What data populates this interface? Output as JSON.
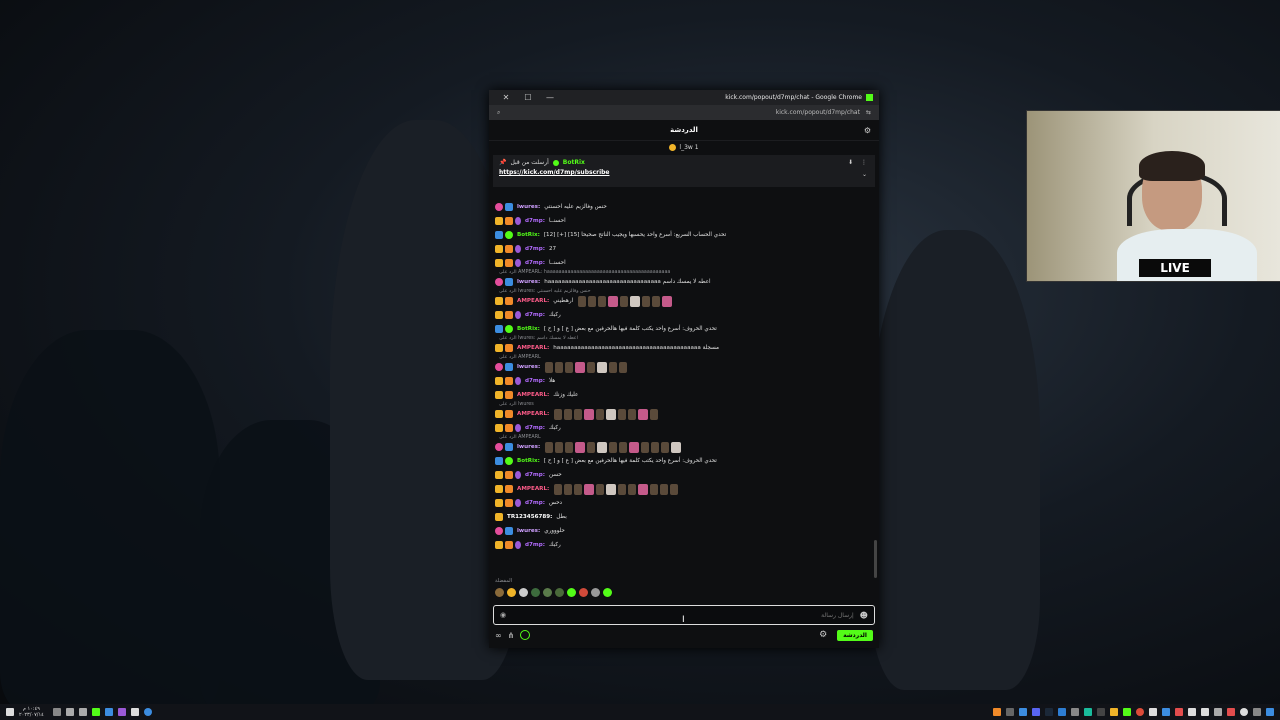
{
  "window": {
    "title": "kick.com/popout/d7mp/chat - Google Chrome",
    "url": "kick.com/popout/d7mp/chat"
  },
  "chat": {
    "header": "الدردشة",
    "sub_user": "l_3w",
    "sub_count": "1",
    "pinned": {
      "label": "أرسلت من قبل",
      "bot": "BotRix",
      "link": "https://kick.com/d7mp/subscribe"
    },
    "messages": [
      {
        "type": "msg",
        "badges": [
          "pink",
          "blue"
        ],
        "user": "lwures",
        "color": "#cfa0ff",
        "text": "حنس وفالزيم عليه احسنتي"
      },
      {
        "type": "msg",
        "badges": [
          "yellow",
          "orange",
          "purple"
        ],
        "user": "d7mp",
        "color": "#b36bff",
        "text": "احسنــا"
      },
      {
        "type": "msg",
        "badges": [
          "blue",
          "green"
        ],
        "user": "BotRix",
        "color": "#53fc18",
        "text": "[12] [+] [15] تحدي الحساب السريع: أسرع واحد يحسبها ويجيب الناتج صحيحا"
      },
      {
        "type": "msg",
        "badges": [
          "yellow",
          "orange",
          "purple"
        ],
        "user": "d7mp",
        "color": "#b36bff",
        "text": "27"
      },
      {
        "type": "msg",
        "badges": [
          "yellow",
          "orange",
          "purple"
        ],
        "user": "d7mp",
        "color": "#b36bff",
        "text": "احسنــا"
      },
      {
        "type": "reply",
        "text": "الرد على AMPEARL: haaaaaaaaaaaaaaaaaaaaaaaaaaaaaaaaaaaaaaaaaa"
      },
      {
        "type": "msg",
        "badges": [
          "pink",
          "blue"
        ],
        "user": "lwures",
        "color": "#cfa0ff",
        "text": "haaaaaaaaaaaaaaaaaaaaaaaaaaaaaaaaa اعطه لا يمسك داسم"
      },
      {
        "type": "reply",
        "text": "الرد على lwures: حنس وفالزيم عليه احسنتي"
      },
      {
        "type": "msg",
        "badges": [
          "yellow",
          "orange"
        ],
        "user": "AMPEARL",
        "color": "#ff5c8a",
        "text": "ارهطيني",
        "emotes": 9
      },
      {
        "type": "msg",
        "badges": [
          "yellow",
          "orange",
          "purple"
        ],
        "user": "d7mp",
        "color": "#b36bff",
        "text": "ركبك"
      },
      {
        "type": "msg",
        "badges": [
          "blue",
          "green"
        ],
        "user": "BotRix",
        "color": "#53fc18",
        "text": "تحدي الحروف: أسرع واحد يكتب كلمة فيها هالحرفين مع بعض [ ع ] و [ ح ]"
      },
      {
        "type": "reply",
        "text": "الرد على lwures: اعطه لا يمسك داسم"
      },
      {
        "type": "msg",
        "badges": [
          "yellow",
          "orange"
        ],
        "user": "AMPEARL",
        "color": "#ff5c8a",
        "text": "haaaaaaaaaaaaaaaaaaaaaaaaaaaaaaaaaaaaaaaaaa مسجلة"
      },
      {
        "type": "reply",
        "text": "الرد على AMPEARL"
      },
      {
        "type": "msg",
        "badges": [
          "pink",
          "blue"
        ],
        "user": "lwures",
        "color": "#cfa0ff",
        "text": "",
        "emotes": 8
      },
      {
        "type": "msg",
        "badges": [
          "yellow",
          "orange",
          "purple"
        ],
        "user": "d7mp",
        "color": "#b36bff",
        "text": "هلا"
      },
      {
        "type": "msg",
        "badges": [
          "yellow",
          "orange"
        ],
        "user": "AMPEARL",
        "color": "#ff5c8a",
        "text": "عليك وزنك"
      },
      {
        "type": "reply",
        "text": "الرد على lwures"
      },
      {
        "type": "msg",
        "badges": [
          "yellow",
          "orange"
        ],
        "user": "AMPEARL",
        "color": "#ff5c8a",
        "text": "",
        "emotes": 10
      },
      {
        "type": "msg",
        "badges": [
          "yellow",
          "orange",
          "purple"
        ],
        "user": "d7mp",
        "color": "#b36bff",
        "text": "ركبك"
      },
      {
        "type": "reply",
        "text": "الرد على AMPEARL"
      },
      {
        "type": "msg",
        "badges": [
          "pink",
          "blue"
        ],
        "user": "lwures",
        "color": "#cfa0ff",
        "text": "",
        "emotes": 13
      },
      {
        "type": "msg",
        "badges": [
          "blue",
          "green"
        ],
        "user": "BotRix",
        "color": "#53fc18",
        "text": "تحدي الحروف: أسرع واحد يكتب كلمة فيها هالحرفين مع بعض [ ع ] و [ ح ]"
      },
      {
        "type": "msg",
        "badges": [
          "yellow",
          "orange",
          "purple"
        ],
        "user": "d7mp",
        "color": "#b36bff",
        "text": "حسن"
      },
      {
        "type": "msg",
        "badges": [
          "yellow",
          "orange"
        ],
        "user": "AMPEARL",
        "color": "#ff5c8a",
        "text": "",
        "emotes": 12
      },
      {
        "type": "msg",
        "badges": [
          "yellow",
          "orange",
          "purple"
        ],
        "user": "d7mp",
        "color": "#b36bff",
        "text": "دحس"
      },
      {
        "type": "msg",
        "badges": [
          "yellow"
        ],
        "user": "TR123456789",
        "color": "#ffffff",
        "text": "بطل"
      },
      {
        "type": "msg",
        "badges": [
          "pink",
          "blue"
        ],
        "user": "lwures",
        "color": "#cfa0ff",
        "text": "حلوووري"
      },
      {
        "type": "msg",
        "badges": [
          "yellow",
          "orange",
          "purple"
        ],
        "user": "d7mp",
        "color": "#b36bff",
        "text": "ركبك"
      }
    ],
    "emote_bar_label": "المفضلة",
    "input_placeholder": "إرسال رسالة",
    "send_label": "الدردشة"
  },
  "cam": {
    "live_label": "LIVE"
  },
  "taskbar": {
    "time": "١٠:٤٩ م",
    "date": "٢٠٢٣/٠٧/١٤"
  }
}
